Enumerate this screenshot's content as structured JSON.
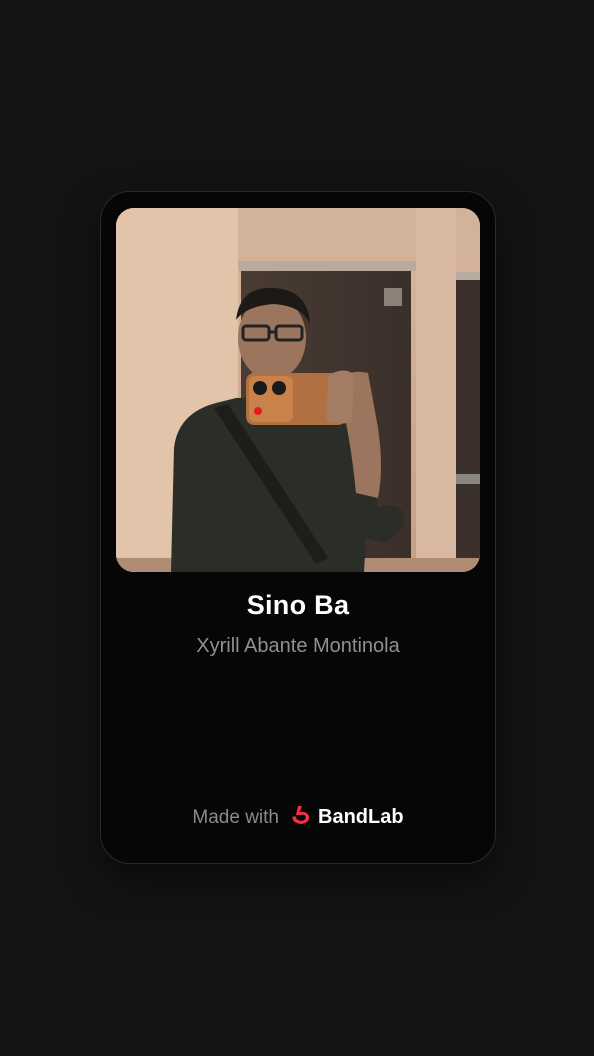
{
  "card": {
    "track_title": "Sino Ba",
    "artist_name": "Xyrill Abante Montinola",
    "footer_prefix": "Made with",
    "brand_name": "BandLab",
    "brand_color": "#f22f46"
  },
  "icons": {
    "brand_logo": "bandlab-logo-icon"
  }
}
